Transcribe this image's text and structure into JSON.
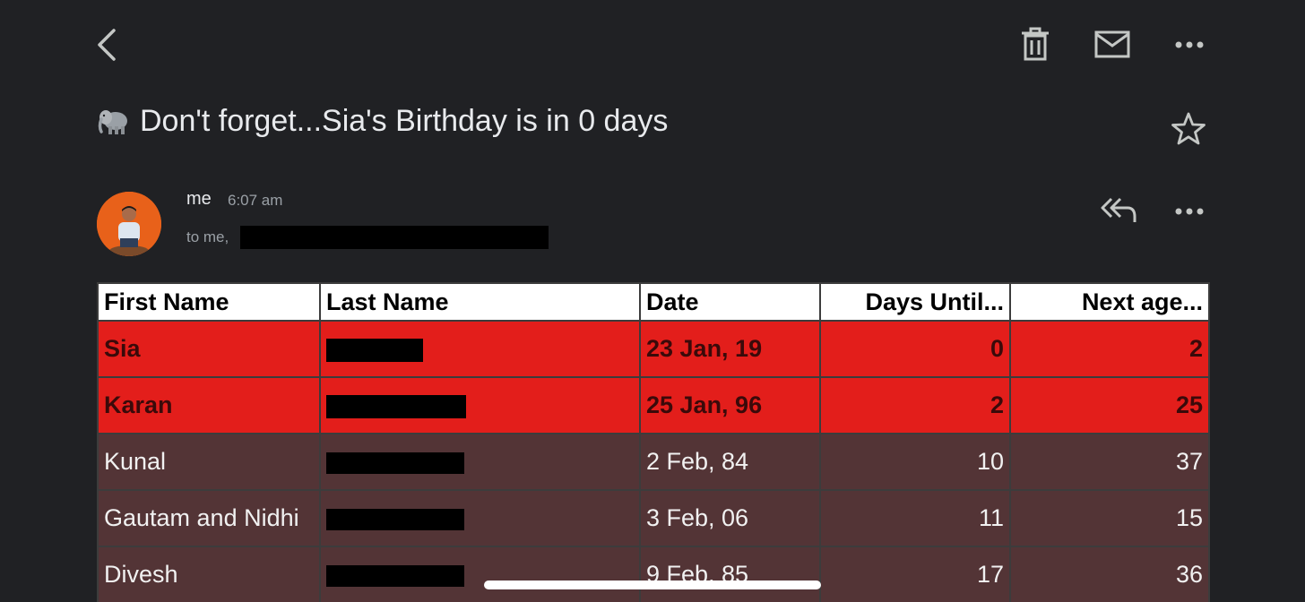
{
  "toolbar": {
    "back_icon": "chevron-left-icon",
    "delete_icon": "trash-icon",
    "mark_unread_icon": "mail-icon",
    "more_icon": "more-horizontal-icon"
  },
  "email": {
    "subject_emoji": "elephant-icon",
    "subject": "Don't forget...Sia's Birthday is in 0 days",
    "star_icon": "star-outline-icon",
    "sender": "me",
    "time": "6:07 am",
    "recipients_prefix": "to me,",
    "reply_all_icon": "reply-all-icon"
  },
  "table": {
    "headers": [
      "First Name",
      "Last Name",
      "Date",
      "Days Until...",
      "Next age..."
    ],
    "rows": [
      {
        "first": "Sia",
        "date": "23 Jan, 19",
        "days": "0",
        "age": "2",
        "highlight": true
      },
      {
        "first": "Karan",
        "date": "25 Jan, 96",
        "days": "2",
        "age": "25",
        "highlight": true
      },
      {
        "first": "Kunal",
        "date": "2 Feb, 84",
        "days": "10",
        "age": "37",
        "highlight": false
      },
      {
        "first": "Gautam and Nidhi",
        "date": "3 Feb, 06",
        "days": "11",
        "age": "15",
        "highlight": false
      },
      {
        "first": "Divesh",
        "date": "9 Feb, 85",
        "days": "17",
        "age": "36",
        "highlight": false
      }
    ]
  },
  "colors": {
    "background": "#202124",
    "highlight_row": "#e31e1b",
    "normal_row": "#533436",
    "header_bg": "#ffffff"
  }
}
